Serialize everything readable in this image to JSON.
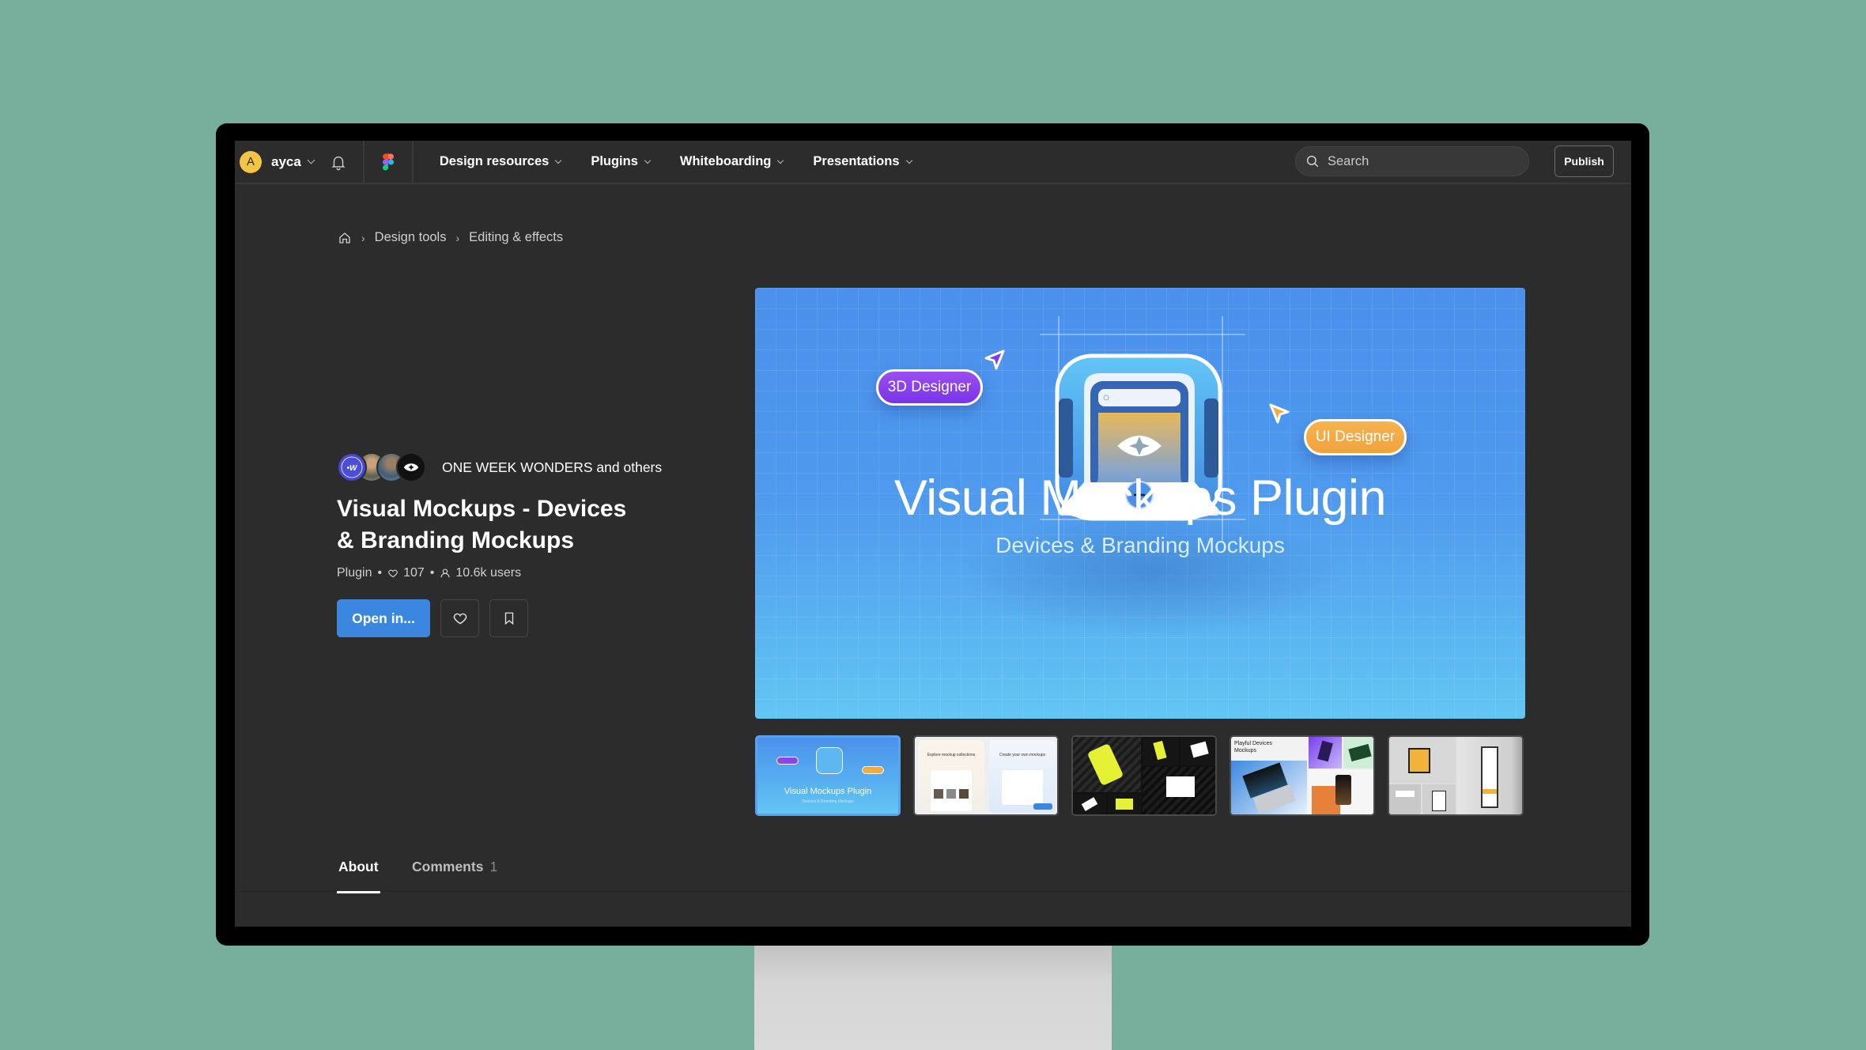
{
  "header": {
    "user": {
      "initial": "A",
      "name": "ayca"
    },
    "nav": [
      {
        "label": "Design resources"
      },
      {
        "label": "Plugins"
      },
      {
        "label": "Whiteboarding"
      },
      {
        "label": "Presentations"
      }
    ],
    "search": {
      "placeholder": "Search"
    },
    "publish_label": "Publish"
  },
  "breadcrumb": {
    "items": [
      {
        "label": "Design tools"
      },
      {
        "label": "Editing & effects"
      }
    ],
    "separator": "›"
  },
  "resource": {
    "creators_text": "ONE WEEK WONDERS and others",
    "title_line1": "Visual Mockups - Devices",
    "title_line2": "& Branding Mockups",
    "type": "Plugin",
    "likes": "107",
    "users": "10.6k users",
    "dot": "•",
    "open_label": "Open in..."
  },
  "hero": {
    "title": "Visual Mockups Plugin",
    "subtitle": "Devices & Branding Mockups",
    "pill_left": "3D Designer",
    "pill_right": "UI Designer",
    "colors": {
      "purple": "#8B44EC",
      "orange": "#F3AB45",
      "blue": "#4A90EC"
    }
  },
  "thumbnails": [
    {
      "label": "Visual Mockups Plugin",
      "sub": "Devices & Branding Mockups",
      "active": true
    },
    {
      "label_left": "Explore mockup collections",
      "label_right": "Create your own mockups"
    },
    {
      "label": ""
    },
    {
      "label": "Playful Devices Mockups"
    },
    {
      "label": ""
    }
  ],
  "tabs": [
    {
      "label": "About",
      "active": true
    },
    {
      "label": "Comments",
      "count": "1"
    }
  ],
  "colors": {
    "background": "#77AF9C",
    "screen": "#2C2C2C",
    "accent": "#3B87E0"
  }
}
